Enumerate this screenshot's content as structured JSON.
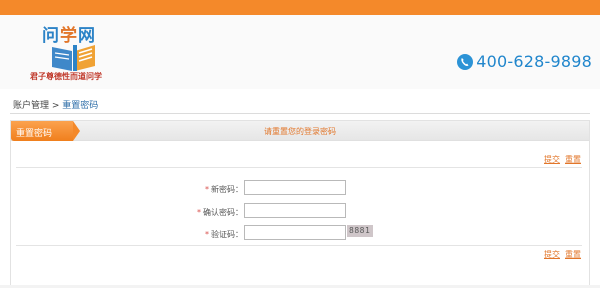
{
  "header": {
    "logo": {
      "title_chars": [
        "问",
        "学",
        "网"
      ],
      "slogan": "君子尊德性而道问学"
    },
    "phone": {
      "icon": "phone-icon",
      "number": "400-628-9898"
    }
  },
  "breadcrumb": {
    "root": "账户管理",
    "separator": " > ",
    "current": "重置密码"
  },
  "panel": {
    "tab_label": "重置密码",
    "hint": "请重置您的登录密码",
    "actions": {
      "submit": "提交",
      "reset": "重置"
    },
    "form": {
      "new_password": {
        "label": "新密码：",
        "value": ""
      },
      "confirm_password": {
        "label": "确认密码：",
        "value": ""
      },
      "captcha": {
        "label": "验证码：",
        "value": "",
        "image_text": "8881"
      },
      "required_mark": "*"
    }
  },
  "colors": {
    "accent": "#f4892a",
    "phone_blue": "#2186cc",
    "link": "#e2762a"
  }
}
